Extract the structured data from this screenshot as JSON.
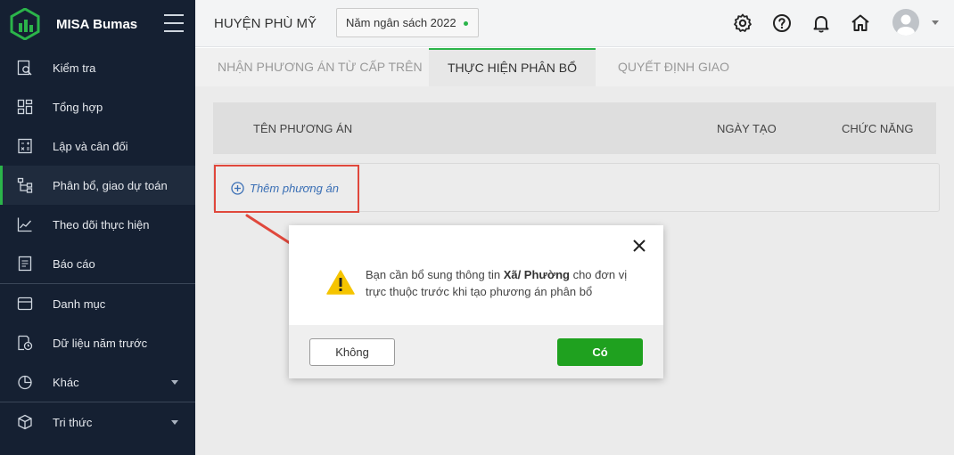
{
  "app": {
    "brand": "MISA Bumas",
    "brand_color": "#2bb44a",
    "sidebar_bg": "#152032"
  },
  "sidebar": {
    "items": [
      {
        "label": "Kiểm tra",
        "icon": "inspect-icon"
      },
      {
        "label": "Tổng hợp",
        "icon": "dashboard-grid-icon"
      },
      {
        "label": "Lập và cân đối",
        "icon": "calculator-icon"
      },
      {
        "label": "Phân bổ, giao dự toán",
        "icon": "hierarchy-icon",
        "active": true
      },
      {
        "label": "Theo dõi thực hiện",
        "icon": "line-chart-icon"
      },
      {
        "label": "Báo cáo",
        "icon": "report-icon"
      },
      {
        "label": "Danh mục",
        "icon": "folder-icon"
      },
      {
        "label": "Dữ liệu năm trước",
        "icon": "history-file-icon"
      },
      {
        "label": "Khác",
        "icon": "pie-chart-icon",
        "has_caret": true
      },
      {
        "label": "Tri thức",
        "icon": "cube-icon",
        "has_caret": true
      }
    ]
  },
  "header": {
    "org_name": "HUYỆN PHÙ MỸ",
    "year_select": "Năm ngân sách 2022",
    "icons": [
      "settings-icon",
      "help-icon",
      "bell-icon",
      "home-icon",
      "avatar"
    ]
  },
  "tabs": [
    {
      "label": "NHẬN PHƯƠNG ÁN TỪ CẤP TRÊN"
    },
    {
      "label": "THỰC HIỆN PHÂN BỔ",
      "active": true
    },
    {
      "label": "QUYẾT ĐỊNH GIAO"
    }
  ],
  "table": {
    "columns": [
      "TÊN PHƯƠNG ÁN",
      "NGÀY TẠO",
      "CHỨC NĂNG"
    ],
    "add_label": "Thêm phương án"
  },
  "dialog": {
    "message_before": "Bạn cần bổ sung thông tin ",
    "message_bold": "Xã/ Phường",
    "message_after": " cho đơn vị trực thuộc trước khi tạo phương án phân bổ",
    "cancel_label": "Không",
    "confirm_label": "Có",
    "confirm_color": "#1fa11f",
    "warning_color": "#f5c400"
  },
  "annotation": {
    "highlight_color": "#e0483c"
  }
}
